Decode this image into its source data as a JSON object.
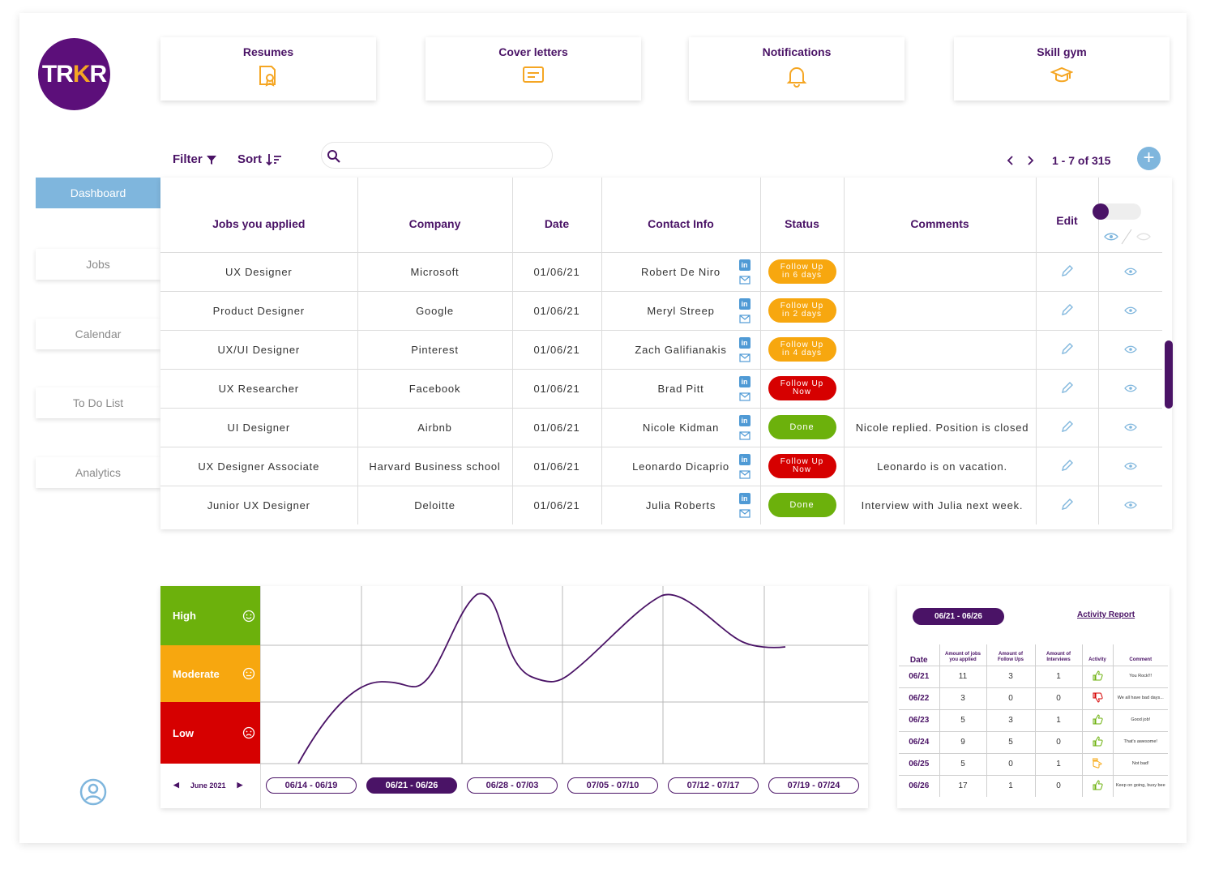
{
  "logo": {
    "text_a": "TR",
    "text_k": "K",
    "text_b": "R"
  },
  "cards": [
    {
      "label": "Resumes",
      "icon": "resume-badge-icon"
    },
    {
      "label": "Cover letters",
      "icon": "cover-letter-icon"
    },
    {
      "label": "Notifications",
      "icon": "bell-icon"
    },
    {
      "label": "Skill gym",
      "icon": "graduation-cap-icon"
    }
  ],
  "sidebar": {
    "items": [
      {
        "label": "Dashboard",
        "active": true
      },
      {
        "label": "Jobs"
      },
      {
        "label": "Calendar"
      },
      {
        "label": "To Do List"
      },
      {
        "label": "Analytics"
      }
    ]
  },
  "toolbar": {
    "filter_label": "Filter",
    "sort_label": "Sort",
    "search_placeholder": "",
    "search_value": ""
  },
  "pagination": {
    "range": "1 - 7 of 315"
  },
  "table": {
    "columns": [
      "Jobs you applied",
      "Company",
      "Date",
      "Contact Info",
      "Status",
      "Comments",
      "Edit"
    ],
    "rows": [
      {
        "job": "UX Designer",
        "company": "Microsoft",
        "date": "01/06/21",
        "contact": "Robert De Niro",
        "status_l1": "Follow Up",
        "status_l2": "in 6 days",
        "status_color": "#f7a70f",
        "comment": ""
      },
      {
        "job": "Product Designer",
        "company": "Google",
        "date": "01/06/21",
        "contact": "Meryl Streep",
        "status_l1": "Follow Up",
        "status_l2": "in 2 days",
        "status_color": "#f7a70f",
        "comment": ""
      },
      {
        "job": "UX/UI Designer",
        "company": "Pinterest",
        "date": "01/06/21",
        "contact": "Zach Galifianakis",
        "status_l1": "Follow Up",
        "status_l2": "in 4 days",
        "status_color": "#f7a70f",
        "comment": ""
      },
      {
        "job": "UX Researcher",
        "company": "Facebook",
        "date": "01/06/21",
        "contact": "Brad Pitt",
        "status_l1": "Follow Up",
        "status_l2": "Now",
        "status_color": "#d60000",
        "comment": ""
      },
      {
        "job": "UI Designer",
        "company": "Airbnb",
        "date": "01/06/21",
        "contact": "Nicole Kidman",
        "status_l1": "Done",
        "status_l2": "",
        "status_color": "#6cb10c",
        "comment": "Nicole replied. Position is closed"
      },
      {
        "job": "UX Designer Associate",
        "company": "Harvard Business school",
        "date": "01/06/21",
        "contact": "Leonardo Dicaprio",
        "status_l1": "Follow Up",
        "status_l2": "Now",
        "status_color": "#d60000",
        "comment": "Leonardo is on vacation."
      },
      {
        "job": "Junior UX Designer",
        "company": "Deloitte",
        "date": "01/06/21",
        "contact": "Julia Roberts",
        "status_l1": "Done",
        "status_l2": "",
        "status_color": "#6cb10c",
        "comment": "Interview with Julia next week."
      }
    ]
  },
  "mood_chart": {
    "levels": [
      {
        "label": "High",
        "color": "#6cb10c",
        "face": "smile-face-icon"
      },
      {
        "label": "Moderate",
        "color": "#f7a70f",
        "face": "neutral-face-icon"
      },
      {
        "label": "Low",
        "color": "#d60000",
        "face": "sad-face-icon"
      }
    ],
    "month": "June 2021",
    "weeks": [
      "06/14 - 06/19",
      "06/21 - 06/26",
      "06/28 - 07/03",
      "07/05 - 07/10",
      "07/12 - 07/17",
      "07/19 - 07/24"
    ],
    "selected_week": 1,
    "line_color": "#4a1366"
  },
  "activity_report": {
    "week": "06/21 - 06/26",
    "link": "Activity Report",
    "headers": {
      "date": "Date",
      "applied_1": "Amount of jobs",
      "applied_2": "you applied",
      "follow_1": "Amount of",
      "follow_2": "Follow Ups",
      "interviews_1": "Amount of",
      "interviews_2": "Interviews",
      "activity": "Activity",
      "comment": "Comment"
    },
    "rows": [
      {
        "date": "06/21",
        "applied": "11",
        "follow": "3",
        "interviews": "1",
        "activity": "thumbs-up-green-icon",
        "color": "#6cb10c",
        "comment": "You Rock!!!"
      },
      {
        "date": "06/22",
        "applied": "3",
        "follow": "0",
        "interviews": "0",
        "activity": "thumbs-down-red-icon",
        "color": "#d60000",
        "comment": "We all have bad days..."
      },
      {
        "date": "06/23",
        "applied": "5",
        "follow": "3",
        "interviews": "1",
        "activity": "thumbs-up-green-icon",
        "color": "#6cb10c",
        "comment": "Good job!"
      },
      {
        "date": "06/24",
        "applied": "9",
        "follow": "5",
        "interviews": "0",
        "activity": "thumbs-up-green-icon",
        "color": "#6cb10c",
        "comment": "That's awesome!"
      },
      {
        "date": "06/25",
        "applied": "5",
        "follow": "0",
        "interviews": "1",
        "activity": "thumbs-sideways-orange-icon",
        "color": "#f7a70f",
        "comment": "Not bad!"
      },
      {
        "date": "06/26",
        "applied": "17",
        "follow": "1",
        "interviews": "0",
        "activity": "thumbs-up-green-icon",
        "color": "#6cb10c",
        "comment": "Keep on going, busy bee"
      }
    ]
  },
  "colors": {
    "brand_purple": "#4a1366",
    "logo_purple": "#5c0f7a",
    "accent_blue": "#7fb6dd",
    "icon_orange": "#f5a623"
  }
}
